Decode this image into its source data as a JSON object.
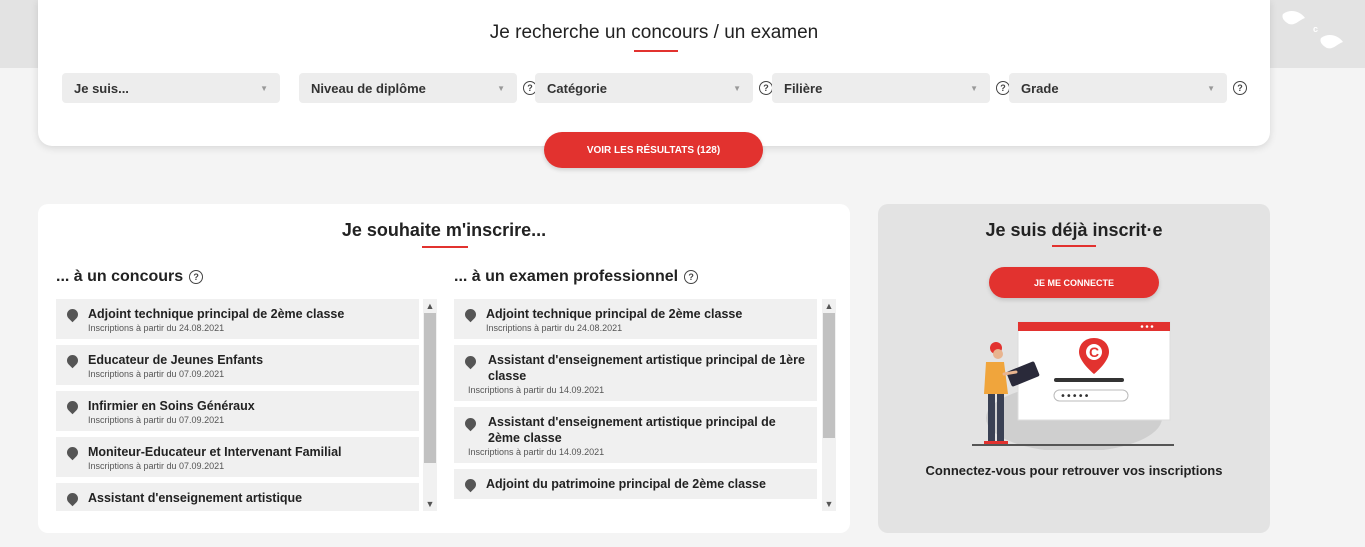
{
  "search": {
    "title": "Je recherche un concours / un examen",
    "filters": [
      {
        "label": "Je suis...",
        "help": false
      },
      {
        "label": "Niveau de diplôme",
        "help": true
      },
      {
        "label": "Catégorie",
        "help": true
      },
      {
        "label": "Filière",
        "help": true
      },
      {
        "label": "Grade",
        "help": true
      }
    ],
    "results_button": "VOIR LES RÉSULTATS (128)"
  },
  "register": {
    "title": "Je souhaite m'inscrire...",
    "concours": {
      "title": "... à un concours",
      "items": [
        {
          "title": "Adjoint technique principal de 2ème classe",
          "date": "Inscriptions à partir du 24.08.2021"
        },
        {
          "title": "Educateur de Jeunes Enfants",
          "date": "Inscriptions à partir du 07.09.2021"
        },
        {
          "title": "Infirmier en Soins Généraux",
          "date": "Inscriptions à partir du 07.09.2021"
        },
        {
          "title": "Moniteur-Educateur et Intervenant Familial",
          "date": "Inscriptions à partir du 07.09.2021"
        },
        {
          "title": "Assistant d'enseignement artistique",
          "date": ""
        }
      ]
    },
    "examens": {
      "title": "... à un examen professionnel",
      "items": [
        {
          "title": "Adjoint technique principal de 2ème classe",
          "date": "Inscriptions à partir du 24.08.2021"
        },
        {
          "title": "Assistant d'enseignement artistique principal de 1ère classe",
          "date": "Inscriptions à partir du 14.09.2021"
        },
        {
          "title": "Assistant d'enseignement artistique principal de 2ème classe",
          "date": "Inscriptions à partir du 14.09.2021"
        },
        {
          "title": "Adjoint du patrimoine principal de 2ème classe",
          "date": ""
        }
      ]
    }
  },
  "login": {
    "title": "Je suis déjà inscrit·e",
    "button": "JE ME CONNECTE",
    "caption": "Connectez-vous pour retrouver vos inscriptions",
    "illustration_logo": "C",
    "password_mask": "•••••"
  },
  "colors": {
    "accent": "#e2322f",
    "background": "#f4f4f4",
    "card": "#ffffff",
    "list_item": "#f0f0f0"
  },
  "icons": {
    "help": "help-circle-icon",
    "pin": "map-pin-icon",
    "caret": "caret-down-icon"
  }
}
